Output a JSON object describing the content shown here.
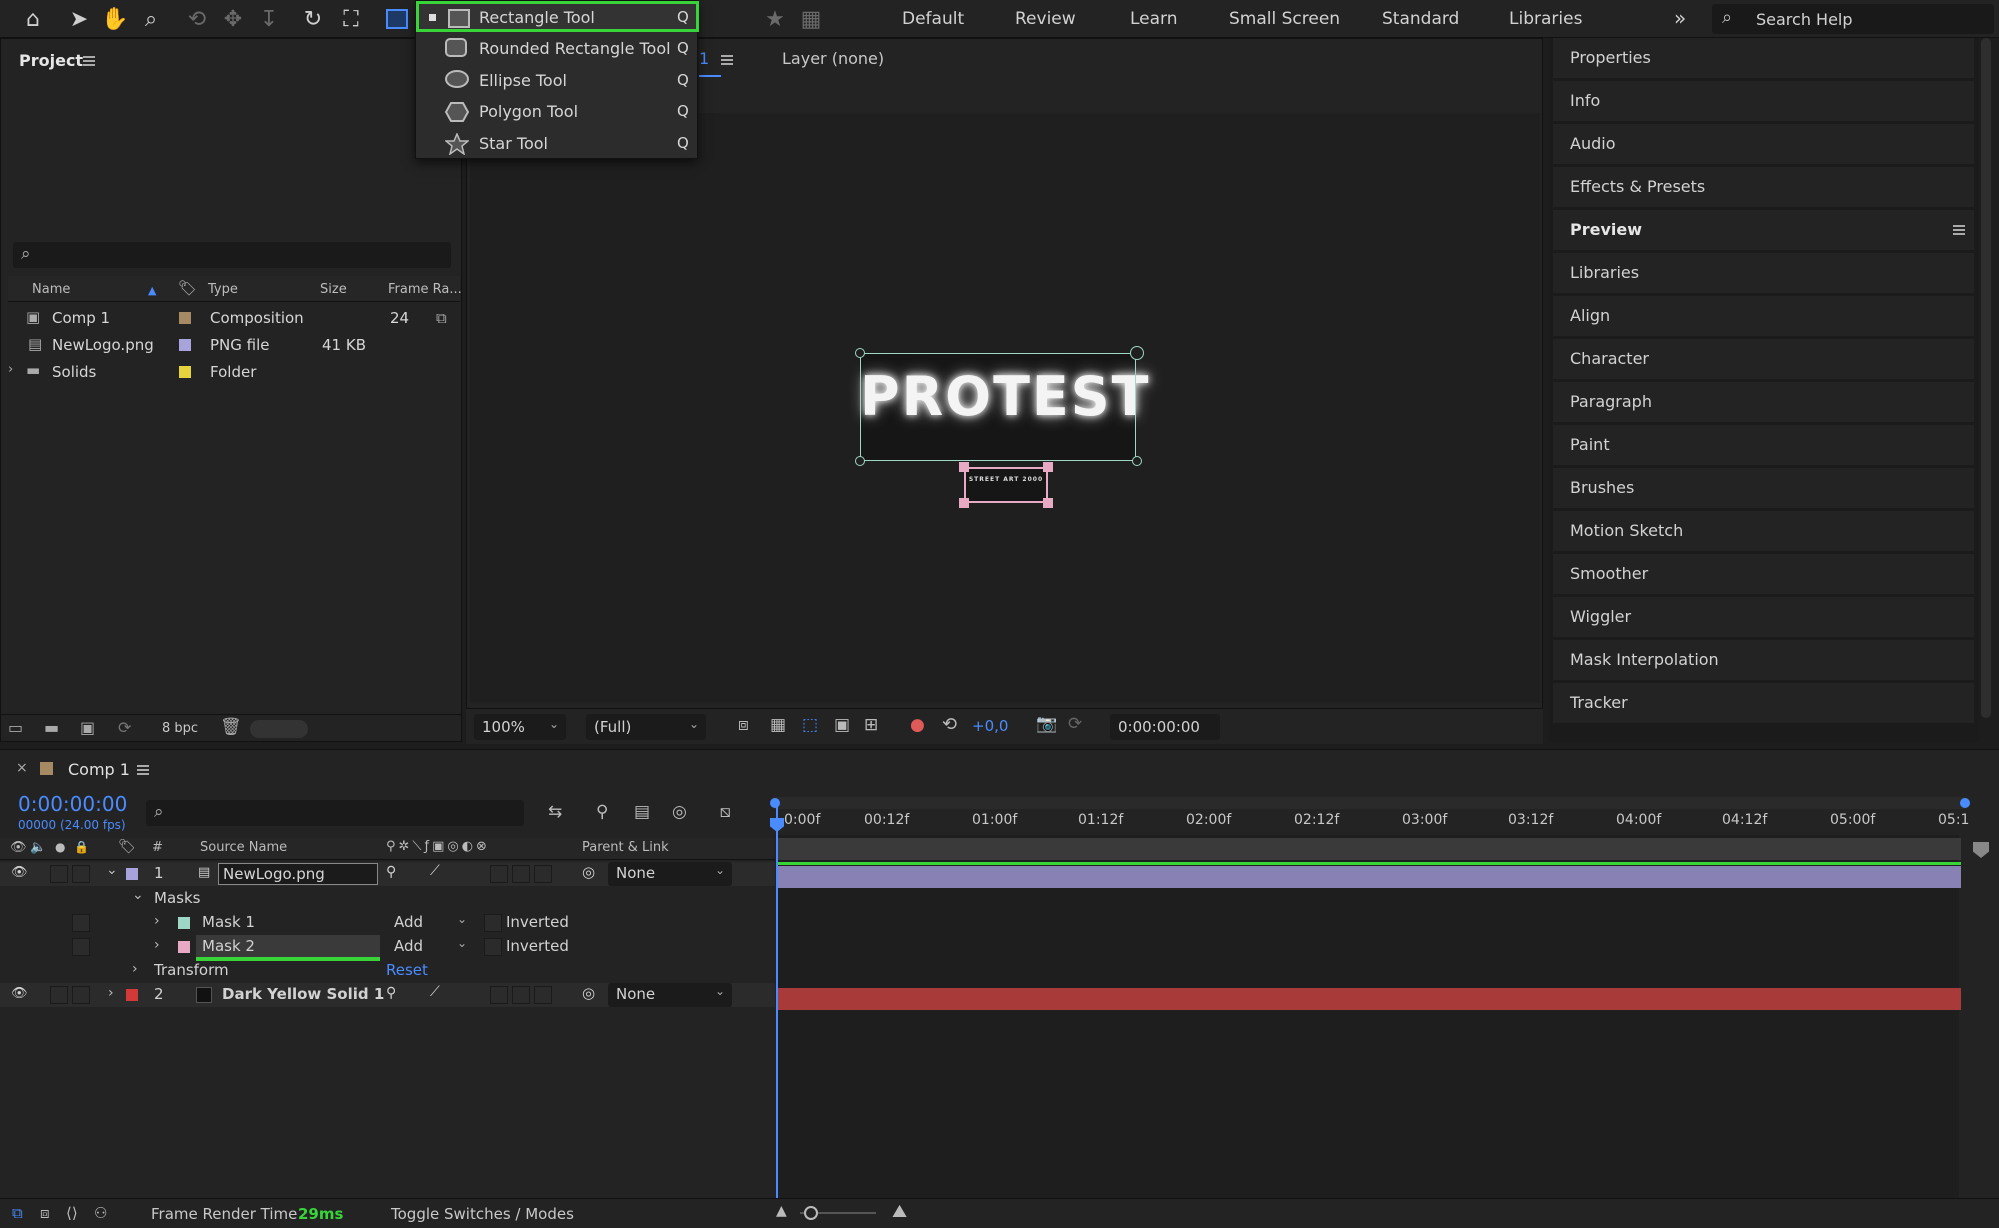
{
  "workspaces": [
    "Default",
    "Review",
    "Learn",
    "Small Screen",
    "Standard",
    "Libraries"
  ],
  "search_help": {
    "placeholder": "Search Help"
  },
  "shape_menu": {
    "items": [
      {
        "label": "Rectangle Tool",
        "shortcut": "Q",
        "icon": "rectangle-icon",
        "selected": true
      },
      {
        "label": "Rounded Rectangle Tool",
        "shortcut": "Q",
        "icon": "rounded-rectangle-icon"
      },
      {
        "label": "Ellipse Tool",
        "shortcut": "Q",
        "icon": "ellipse-icon"
      },
      {
        "label": "Polygon Tool",
        "shortcut": "Q",
        "icon": "polygon-icon"
      },
      {
        "label": "Star Tool",
        "shortcut": "Q",
        "icon": "star-icon"
      }
    ],
    "highlight_color": "#39d33a"
  },
  "project": {
    "title": "Project",
    "columns": {
      "name": "Name",
      "type": "Type",
      "size": "Size",
      "frame_rate": "Frame Ra..."
    },
    "items": [
      {
        "name": "Comp 1",
        "type": "Composition",
        "size": "",
        "frame_rate": "24",
        "label_color": "#a58a63"
      },
      {
        "name": "NewLogo.png",
        "type": "PNG file",
        "size": "41 KB",
        "frame_rate": "",
        "label_color": "#a9a3db"
      },
      {
        "name": "Solids",
        "type": "Folder",
        "size": "",
        "frame_rate": "",
        "label_color": "#e6d23b"
      }
    ],
    "bpc": "8 bpc"
  },
  "viewer": {
    "tab_suffix": "1",
    "layer_tab": "Layer (none)",
    "logo_text": "PROTEST",
    "sub_text": "STREET ART 2000",
    "zoom": "100%",
    "resolution": "(Full)",
    "exposure": "+0,0",
    "timecode": "0:00:00:00"
  },
  "right_panel": {
    "items": [
      "Properties",
      "Info",
      "Audio",
      "Effects & Presets",
      "Preview",
      "Libraries",
      "Align",
      "Character",
      "Paragraph",
      "Paint",
      "Brushes",
      "Motion Sketch",
      "Smoother",
      "Wiggler",
      "Mask Interpolation",
      "Tracker"
    ]
  },
  "timeline": {
    "comp_tab": "Comp 1",
    "timecode": "0:00:00:00",
    "frame_info": "00000 (24.00 fps)",
    "col_hash": "#",
    "col_source": "Source Name",
    "col_parent": "Parent & Link",
    "ruler": [
      "0:00f",
      "00:12f",
      "01:00f",
      "01:12f",
      "02:00f",
      "02:12f",
      "03:00f",
      "03:12f",
      "04:00f",
      "04:12f",
      "05:00f",
      "05:1"
    ],
    "layers": [
      {
        "num": "1",
        "name": "NewLogo.png",
        "parent": "None",
        "label_color": "#a9a3db"
      },
      {
        "num": "2",
        "name": "Dark Yellow Solid 1",
        "parent": "None",
        "label_color": "#d23a3a"
      }
    ],
    "masks_label": "Masks",
    "masks": [
      {
        "name": "Mask 1",
        "mode": "Add",
        "inverted": "Inverted",
        "color": "#9fd7c6"
      },
      {
        "name": "Mask 2",
        "mode": "Add",
        "inverted": "Inverted",
        "color": "#e8a9c4"
      }
    ],
    "transform_label": "Transform",
    "reset_label": "Reset"
  },
  "status": {
    "frame_render_label": "Frame Render Time",
    "frame_render_value": "29ms",
    "toggle_label": "Toggle Switches / Modes"
  }
}
